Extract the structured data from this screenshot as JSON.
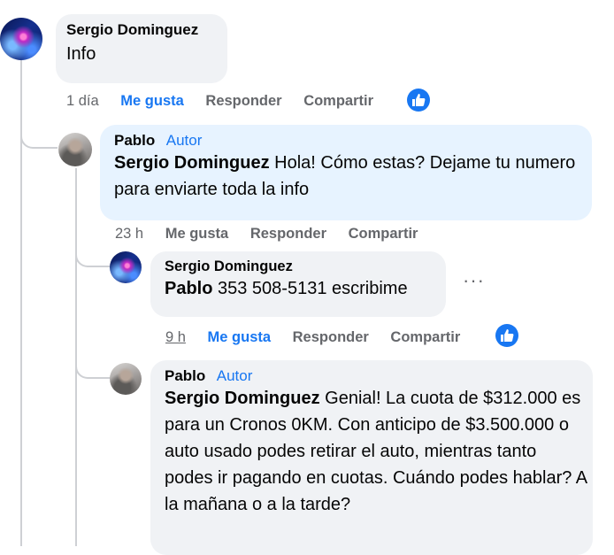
{
  "comments": [
    {
      "author": "Sergio Dominguez",
      "badge": "",
      "mention": "",
      "text": "Info",
      "time": "1 día",
      "like": "Me gusta",
      "reply": "Responder",
      "share": "Compartir",
      "reaction": "like-reaction-icon"
    },
    {
      "author": "Pablo",
      "badge": "Autor",
      "mention": "Sergio Dominguez",
      "text": " Hola! Cómo estas? Dejame tu numero para enviarte toda la info",
      "time": "23 h",
      "like": "Me gusta",
      "reply": "Responder",
      "share": "Compartir"
    },
    {
      "author": "Sergio Dominguez",
      "badge": "",
      "mention": "Pablo",
      "text": " 353 508-5131 escribime",
      "time": "9 h",
      "like": "Me gusta",
      "reply": "Responder",
      "share": "Compartir",
      "reaction": "like-reaction-icon",
      "more": "···"
    },
    {
      "author": "Pablo",
      "badge": "Autor",
      "mention": "Sergio Dominguez",
      "text": " Genial! La cuota de $312.000 es para un Cronos 0KM. Con anticipo de $3.500.000 o auto usado podes retirar el auto, mientras tanto podes ir pagando en cuotas. Cuándo podes hablar? A la mañana o a la tarde?"
    }
  ],
  "colors": {
    "accent": "#1877f2",
    "bubble_gray": "#f0f2f5",
    "bubble_blue": "#e7f3ff",
    "muted": "#65676b"
  }
}
